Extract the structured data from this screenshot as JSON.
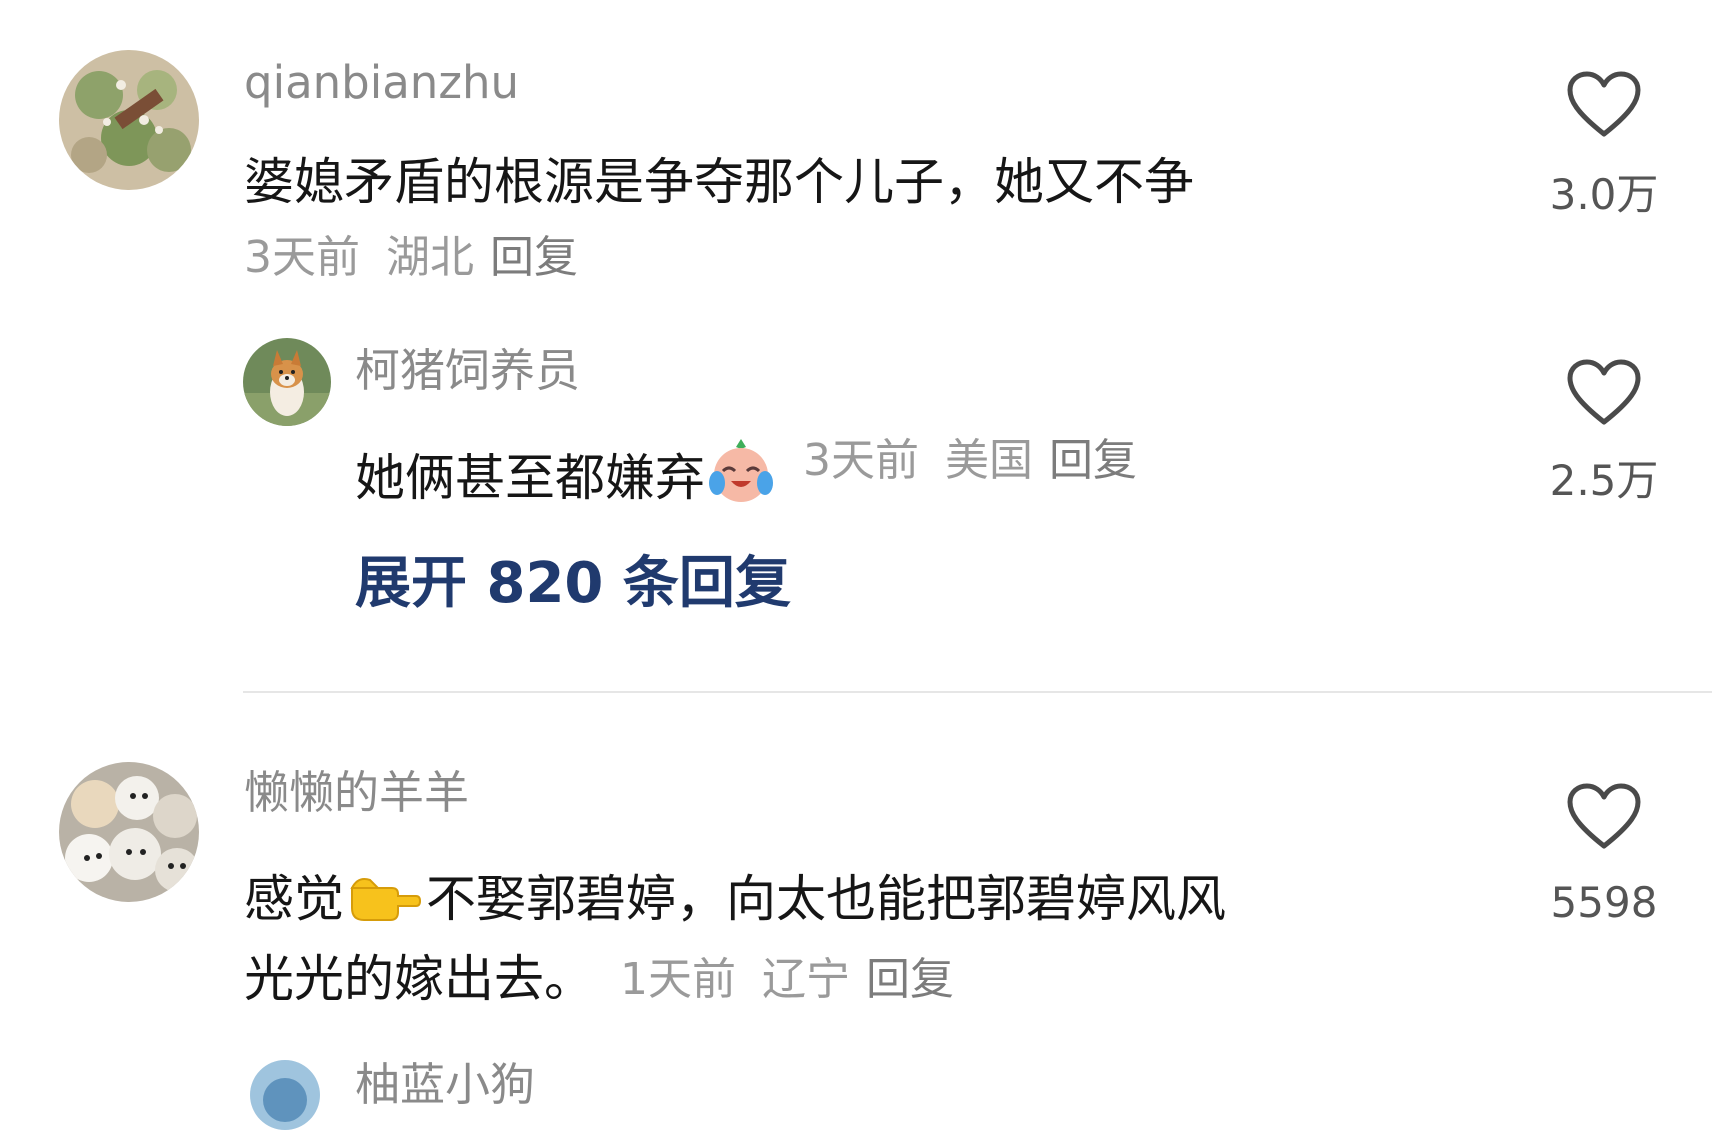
{
  "comments": [
    {
      "username": "qianbianzhu",
      "text": "婆媳矛盾的根源是争夺那个儿子，她又不争",
      "time": "3天前",
      "location": "湖北",
      "reply_label": "回复",
      "likes": "3.0万"
    },
    {
      "username": "懒懒的羊羊",
      "text_part1": "感觉",
      "text_part2": "不娶郭碧婷，向太也能把郭碧婷风风",
      "text_line2": "光光的嫁出去。",
      "time": "1天前",
      "location": "辽宁",
      "reply_label": "回复",
      "likes": "5598"
    }
  ],
  "reply": {
    "username": "柯猪饲养员",
    "text": "她俩甚至都嫌弃",
    "time": "3天前",
    "location": "美国",
    "reply_label": "回复",
    "likes": "2.5万"
  },
  "expand_label": "展开 820 条回复",
  "partial_next_username": "柚蓝小狗",
  "icons": {
    "like": "heart-outline-icon",
    "laughing_crying_emoji": "laughing-crying-emoji-icon",
    "pointing_right_emoji": "pointing-right-emoji-icon"
  },
  "colors": {
    "expand_link": "#203a6e",
    "username": "#8a8a8a",
    "meta": "#9a9a9a"
  }
}
